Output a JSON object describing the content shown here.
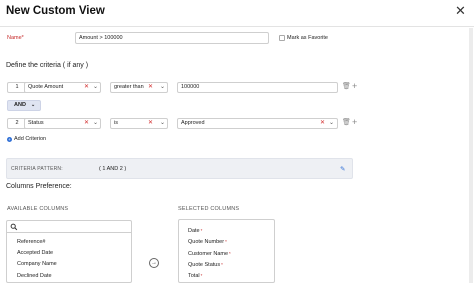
{
  "header": {
    "title": "New Custom View",
    "close_glyph": "✕"
  },
  "name_field": {
    "label": "Name*",
    "value": "Amount > 100000"
  },
  "favorite": {
    "label": "Mark as Favorite",
    "checked": false
  },
  "criteria": {
    "title": "Define the criteria ( if any )",
    "rows": [
      {
        "number": "1",
        "field": "Quote Amount",
        "operator": "greater than",
        "value": "100000"
      },
      {
        "number": "2",
        "field": "Status",
        "operator": "is",
        "value": "Approved"
      }
    ],
    "connector": "AND",
    "add_label": "Add Criterion",
    "clear_glyph": "✕",
    "chevron_glyph": "⌄",
    "delete_glyph": "🗑",
    "add_glyph": "+"
  },
  "pattern": {
    "label": "CRITERIA PATTERN:",
    "value": "( 1 AND 2 )",
    "edit_glyph": "✎"
  },
  "columns": {
    "title": "Columns Preference:",
    "available_heading": "AVAILABLE COLUMNS",
    "selected_heading": "SELECTED COLUMNS",
    "available": [
      "Reference#",
      "Accepted Date",
      "Company Name",
      "Declined Date"
    ],
    "selected": [
      {
        "label": "Date",
        "required": "*"
      },
      {
        "label": "Quote Number",
        "required": "*"
      },
      {
        "label": "Customer Name",
        "required": "*"
      },
      {
        "label": "Quote Status",
        "required": "*"
      },
      {
        "label": "Total",
        "required": "*"
      }
    ],
    "move_glyph": "→"
  },
  "colors": {
    "accent": "#2f6fd6",
    "required": "#c62828",
    "clear": "#d32f2f"
  }
}
